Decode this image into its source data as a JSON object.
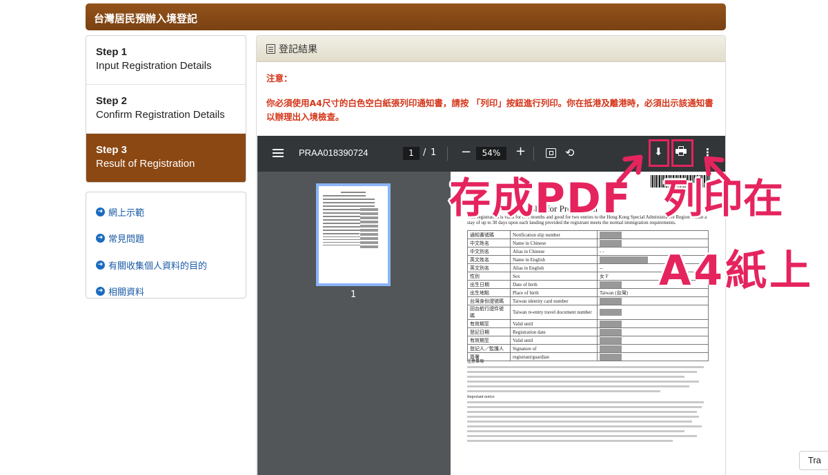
{
  "header": {
    "title": "台灣居民預辦入境登記"
  },
  "steps": [
    {
      "num": "Step 1",
      "label": "Input Registration Details"
    },
    {
      "num": "Step 2",
      "label": "Confirm Registration Details"
    },
    {
      "num": "Step 3",
      "label": "Result of Registration"
    }
  ],
  "active_step": 3,
  "links": [
    {
      "label": "網上示範"
    },
    {
      "label": "常見問題"
    },
    {
      "label": "有關收集個人資料的目的"
    },
    {
      "label": "相關資料"
    }
  ],
  "panel": {
    "title": "登記結果",
    "notice_label": "注意：",
    "notice_text": "你必須使用A4尺寸的白色空白紙張列印通知書，請按 「列印」按鈕進行列印。你在抵港及離港時，必須出示該通知書以辦理出入境檢查。"
  },
  "viewer": {
    "doc_name": "PRAA018390724",
    "current_page": "1",
    "page_sep": "/",
    "total_pages": "1",
    "zoom": "54%",
    "thumbnail_number": "1"
  },
  "paper": {
    "title_zh": "台",
    "title_en": "Slip for Pre-arrival",
    "intro": "This registration is valid for two months and good for two entries to the Hong Kong Special Administrative Region within a stay of up to 30 days upon each landing provided the registrant meets the normal immigration requirements.",
    "rows": [
      {
        "zh": "通知書號碼",
        "en": "Notification slip number",
        "val": ""
      },
      {
        "zh": "中文姓名",
        "en": "Name in Chinese",
        "val": ""
      },
      {
        "zh": "中文別名",
        "en": "Alias in Chinese",
        "val": "- -"
      },
      {
        "zh": "英文姓名",
        "en": "Name in English",
        "val": ""
      },
      {
        "zh": "英文別名",
        "en": "Alias in English",
        "val": "--"
      },
      {
        "zh": "性別",
        "en": "Sex",
        "val": "女 F"
      },
      {
        "zh": "出生日期",
        "en": "Date of birth",
        "val": ""
      },
      {
        "zh": "出生地點",
        "en": "Place of birth",
        "val": "Taiwan (台灣)"
      },
      {
        "zh": "台灣身份證號碼",
        "en": "Taiwan identity card number",
        "val": ""
      },
      {
        "zh": "回台航行證件號碼",
        "en": "Taiwan re-entry travel document number",
        "val": ""
      },
      {
        "zh": "有效期至",
        "en": "Valid until",
        "val": ""
      },
      {
        "zh": "登記日期",
        "en": "Registration date",
        "val": ""
      },
      {
        "zh": "有效期至",
        "en": "Valid until",
        "val": ""
      },
      {
        "zh": "登記人／監護人",
        "en": "Signature of",
        "val": ""
      },
      {
        "zh": "簽署",
        "en": "registrant/guardian",
        "val": ""
      }
    ],
    "notes_zh_label": "注意事項",
    "notes_en_label": "Important notice"
  },
  "annotations": {
    "save_pdf": "存成PDF",
    "print_on": "列印在",
    "a4_paper": "A4紙上"
  },
  "translate_button": "Tra",
  "colors": {
    "header_brown": "#8b4813",
    "notice_red": "#d43418",
    "link_blue": "#1a5aa5",
    "annotation_pink": "#e5245e",
    "viewer_bg": "#525659",
    "viewer_toolbar": "#323639"
  }
}
